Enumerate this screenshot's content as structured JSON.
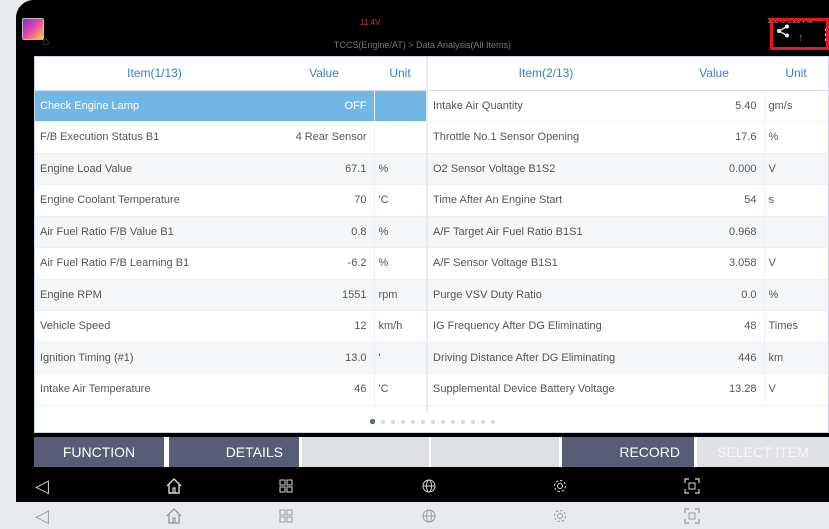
{
  "title_bar": {
    "title": "TCCS(Engine/AT) > Data Analysis(All Items)",
    "status_center": "11:4V",
    "status_right": "100% 3:26 PM"
  },
  "left_table": {
    "headers": {
      "item": "Item(1/13)",
      "value": "Value",
      "unit": "Unit"
    },
    "rows": [
      {
        "name": "Check Engine Lamp",
        "value": "OFF",
        "unit": ""
      },
      {
        "name": "F/B Execution Status B1",
        "value": "4 Rear Sensor",
        "unit": ""
      },
      {
        "name": "Engine Load Value",
        "value": "67.1",
        "unit": "%"
      },
      {
        "name": "Engine Coolant Temperature",
        "value": "70",
        "unit": "'C"
      },
      {
        "name": "Air Fuel Ratio F/B Value B1",
        "value": "0.8",
        "unit": "%"
      },
      {
        "name": "Air Fuel Ratio F/B Learning B1",
        "value": "-6.2",
        "unit": "%"
      },
      {
        "name": "Engine RPM",
        "value": "1551",
        "unit": "rpm"
      },
      {
        "name": "Vehicle Speed",
        "value": "12",
        "unit": "km/h"
      },
      {
        "name": "Ignition Timing (#1)",
        "value": "13.0",
        "unit": "'"
      },
      {
        "name": "Intake Air Temperature",
        "value": "46",
        "unit": "'C"
      }
    ]
  },
  "right_table": {
    "headers": {
      "item": "Item(2/13)",
      "value": "Value",
      "unit": "Unit"
    },
    "rows": [
      {
        "name": "Intake Air Quantity",
        "value": "5.40",
        "unit": "gm/s"
      },
      {
        "name": "Throttle No.1 Sensor Opening",
        "value": "17.6",
        "unit": "%"
      },
      {
        "name": "O2 Sensor Voltage B1S2",
        "value": "0.000",
        "unit": "V"
      },
      {
        "name": "Time After An Engine Start",
        "value": "54",
        "unit": "s"
      },
      {
        "name": "A/F Target Air Fuel Ratio B1S1",
        "value": "0.968",
        "unit": ""
      },
      {
        "name": "A/F Sensor Voltage B1S1",
        "value": "3.058",
        "unit": "V"
      },
      {
        "name": "Purge VSV Duty Ratio",
        "value": "0.0",
        "unit": "%"
      },
      {
        "name": "IG Frequency After DG Eliminating",
        "value": "48",
        "unit": "Times"
      },
      {
        "name": "Driving Distance After DG Eliminating",
        "value": "446",
        "unit": "km"
      },
      {
        "name": "Supplemental Device Battery Voltage",
        "value": "13.28",
        "unit": "V"
      }
    ]
  },
  "pagination": {
    "current": 1,
    "total": 13
  },
  "buttons": {
    "function": "FUNCTION",
    "details": "DETAILS",
    "record": "RECORD",
    "select_item": "SELECT ITEM"
  },
  "nav_icons": [
    "back-icon",
    "home-icon",
    "recent-apps-icon",
    "browser-icon",
    "settings-icon",
    "screenshot-icon"
  ],
  "colors": {
    "selected_row": "#72b6e3",
    "header_text": "#3b7dc4",
    "button_dark": "#565d75",
    "highlight_box": "#e5181e"
  }
}
